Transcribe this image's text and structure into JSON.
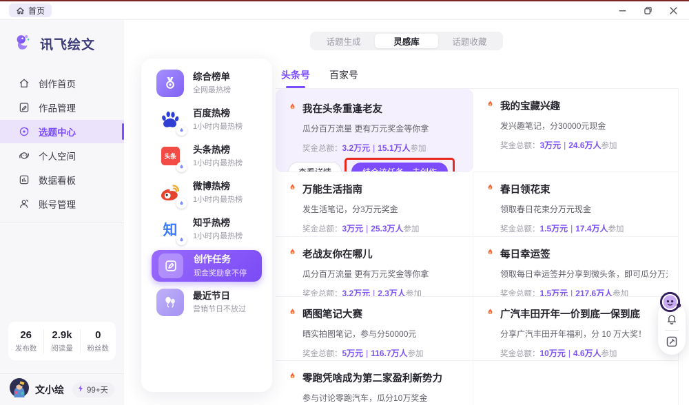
{
  "window": {
    "home_tab": "首页"
  },
  "brand": {
    "name": "讯飞绘文",
    "accent": "#7c4dff"
  },
  "sidebar": {
    "items": [
      {
        "label": "创作首页",
        "icon": "home-icon",
        "active": false
      },
      {
        "label": "作品管理",
        "icon": "works-icon",
        "active": false
      },
      {
        "label": "选题中心",
        "icon": "topic-icon",
        "active": true
      },
      {
        "label": "个人空间",
        "icon": "space-icon",
        "active": false
      },
      {
        "label": "数据看板",
        "icon": "dashboard-icon",
        "active": false
      },
      {
        "label": "账号管理",
        "icon": "account-icon",
        "active": false
      }
    ],
    "stats": [
      {
        "value": "26",
        "label": "发布数"
      },
      {
        "value": "2.9k",
        "label": "阅读量"
      },
      {
        "value": "0",
        "label": "粉丝数"
      }
    ],
    "user": {
      "name": "文小绘",
      "badge": "99+天"
    }
  },
  "hotlist": {
    "items": [
      {
        "title": "综合榜单",
        "subtitle": "全网最热榜",
        "icon": "medal-icon",
        "style": "medal"
      },
      {
        "title": "百度热榜",
        "subtitle": "1小时内最热榜",
        "icon": "baidu-icon",
        "style": "baidu",
        "badge": true
      },
      {
        "title": "头条热榜",
        "subtitle": "1小时内最热榜",
        "icon": "toutiao-icon",
        "style": "toutiao",
        "icon_text": "头条",
        "badge": true
      },
      {
        "title": "微博热榜",
        "subtitle": "1小时内最热榜",
        "icon": "weibo-icon",
        "style": "weibo",
        "badge": true
      },
      {
        "title": "知乎热榜",
        "subtitle": "1小时内最热榜",
        "icon": "zhihu-icon",
        "style": "zhihu",
        "icon_text": "知",
        "badge": true
      },
      {
        "title": "创作任务",
        "subtitle": "现金奖励拿不停",
        "icon": "task-pen-icon",
        "style": "task",
        "active": true
      },
      {
        "title": "最近节日",
        "subtitle": "营销节日不放过",
        "icon": "festival-balloons-icon",
        "style": "festival"
      }
    ]
  },
  "main": {
    "segments": [
      {
        "label": "话题生成",
        "active": false
      },
      {
        "label": "灵感库",
        "active": true
      },
      {
        "label": "话题收藏",
        "active": false
      }
    ],
    "tabs": [
      {
        "label": "头条号",
        "active": true
      },
      {
        "label": "百家号",
        "active": false
      }
    ],
    "prize_label": "奖金总额：",
    "sep": "|",
    "participate_suffix": "参加",
    "cards": [
      {
        "title": "我在头条重逢老友",
        "desc": "瓜分百万流量 更有万元奖金等你拿",
        "amount": "3.2万元",
        "participants": "15.1万人",
        "highlighted": true,
        "buttons": [
          "查看详情",
          "结合该任务，去创作"
        ]
      },
      {
        "title": "我的宝藏兴趣",
        "desc": "发兴趣笔记，分30000元现金",
        "amount": "3万元",
        "participants": "24.6万人"
      },
      {
        "title": "万能生活指南",
        "desc": "发生活笔记，分3万元奖金",
        "amount": "3万元",
        "participants": "25.3万人"
      },
      {
        "title": "春日领花束",
        "desc": "领取春日花束分万元现金",
        "amount": "1.5万元",
        "participants": "17.4万人"
      },
      {
        "title": "老战友你在哪儿",
        "desc": "瓜分百万流量 更有万元奖金等你拿",
        "amount": "3.2万元",
        "participants": "2.3万人"
      },
      {
        "title": "每日幸运签",
        "desc": "领取每日幸运签并分享到微头条，即可瓜分万元现金奖励",
        "amount": "1.5万元",
        "participants": "217.6万人"
      },
      {
        "title": "晒图笔记大赛",
        "desc": "晒实拍图笔记，参与分50000元",
        "amount": "5万元",
        "participants": "116.7万人"
      },
      {
        "title": "广汽丰田开年一价到底一保到底",
        "desc": "分享广汽丰田开年福利，分 10 万大奖！",
        "amount": "10万元",
        "participants": "4.6万人"
      },
      {
        "title": "零跑凭啥成为第二家盈利新势力",
        "desc": "参与讨论零跑汽车，瓜分10万奖金",
        "amount": null,
        "participants": null
      }
    ]
  },
  "annotation": {
    "color": "#e8281e"
  }
}
